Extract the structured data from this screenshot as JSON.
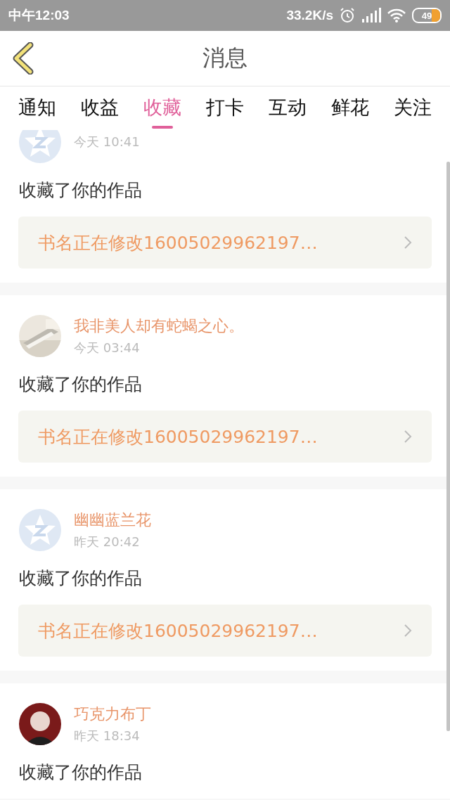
{
  "status_bar": {
    "time": "中午12:03",
    "speed": "33.2K/s",
    "battery": "49"
  },
  "header": {
    "title": "消息"
  },
  "tabs": [
    {
      "label": "通知",
      "selected": false
    },
    {
      "label": "收益",
      "selected": false
    },
    {
      "label": "收藏",
      "selected": true
    },
    {
      "label": "打卡",
      "selected": false
    },
    {
      "label": "互动",
      "selected": false
    },
    {
      "label": "鲜花",
      "selected": false
    },
    {
      "label": "关注",
      "selected": false
    }
  ],
  "messages": [
    {
      "kind": "default",
      "time": "今天 10:41",
      "action": "收藏了你的作品",
      "book": "书名正在修改16005029962197…"
    },
    {
      "name": "我非美人却有蛇蝎之心。",
      "time": "今天 03:44",
      "action": "收藏了你的作品",
      "book": "书名正在修改16005029962197…"
    },
    {
      "kind": "default",
      "name": "幽幽蓝兰花",
      "time": "昨天 20:42",
      "action": "收藏了你的作品",
      "book": "书名正在修改16005029962197…"
    },
    {
      "kind": "person",
      "name": "巧克力布丁",
      "time": "昨天 18:34",
      "action": "收藏了你的作品"
    }
  ]
}
